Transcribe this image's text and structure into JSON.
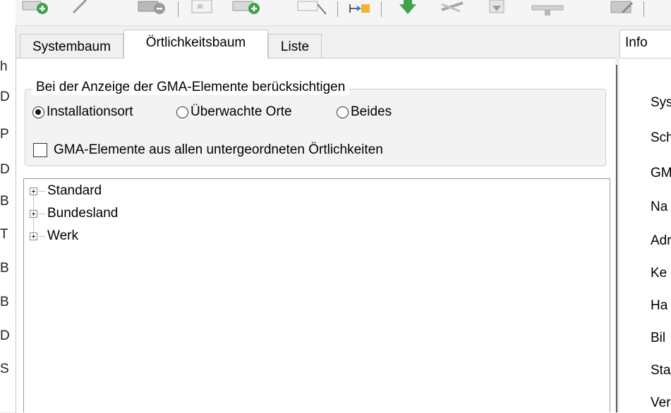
{
  "left_column_fragments": [
    "h",
    "D",
    "P",
    "D",
    "B",
    "T",
    "B",
    "B",
    "D",
    "S"
  ],
  "toolbar": {
    "icons": [
      "add-green-icon",
      "wand-icon",
      "delete-icon",
      "properties-icon",
      "add-green-icon",
      "select-icon",
      "import-icon",
      "move-down-green-icon",
      "transfer-icon",
      "download-icon",
      "network-icon",
      "monitor-icon"
    ]
  },
  "tabs": [
    "Systembaum",
    "Örtlichkeitsbaum",
    "Liste"
  ],
  "active_tab": "Örtlichkeitsbaum",
  "info_tab": "Info",
  "display_group": {
    "legend": "Bei der Anzeige der GMA-Elemente berücksichtigen",
    "radios": [
      {
        "label": "Installationsort",
        "checked": true
      },
      {
        "label": "Überwachte Orte",
        "checked": false
      },
      {
        "label": "Beides",
        "checked": false
      }
    ],
    "checkbox": {
      "label": "GMA-Elemente aus allen untergeordneten Örtlichkeiten",
      "checked": false
    }
  },
  "tree": [
    "Standard",
    "Bundesland",
    "Werk"
  ],
  "info_labels": [
    "Sys",
    "Sch",
    "GM",
    "Na",
    "Adr",
    "Ke",
    "Ha",
    "Bil",
    "Sta",
    "Ver"
  ]
}
